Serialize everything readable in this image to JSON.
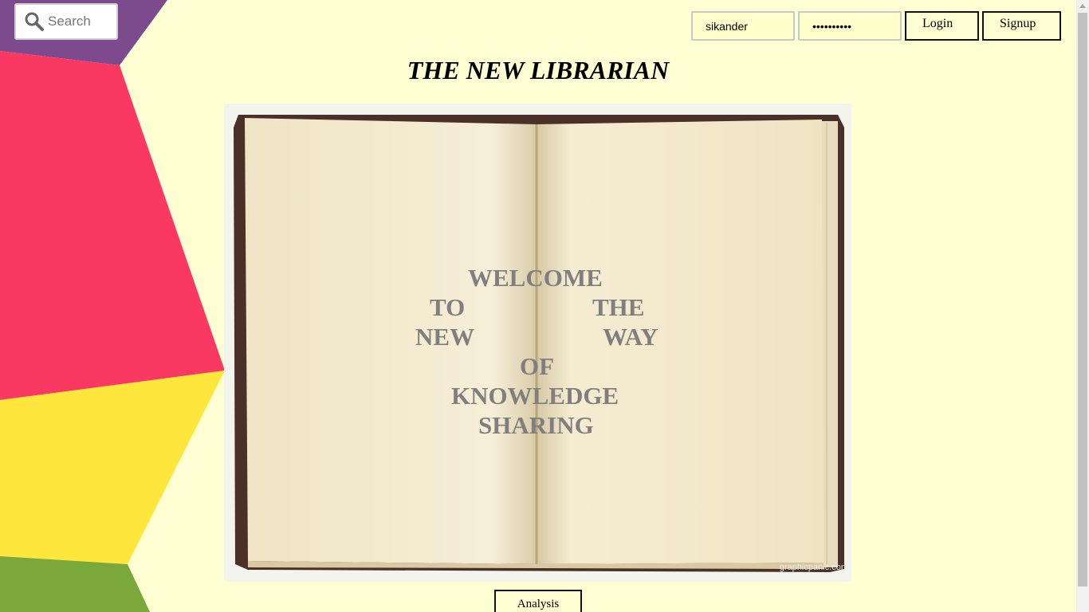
{
  "search": {
    "placeholder": "Search",
    "icon": "search-icon"
  },
  "login": {
    "username_value": "sikander",
    "password_value": "••••••••••",
    "login_label": "Login",
    "signup_label": "Signup"
  },
  "title": "THE NEW LIBRARIAN",
  "hero": {
    "line1": "WELCOME",
    "line2_left": "TO",
    "line2_right": "THE",
    "line3_left": "NEW",
    "line3_right": "WAY",
    "line4": "OF",
    "line5": "KNOWLEDGE",
    "line6": "SHARING",
    "watermark": "graphicpanic.com"
  },
  "analysis_label": "Analysis",
  "colors": {
    "background": "#ffffd4",
    "purple": "#7e4a8e",
    "pink": "#f93961",
    "yellow": "#fee63c",
    "green": "#7aa83a"
  }
}
